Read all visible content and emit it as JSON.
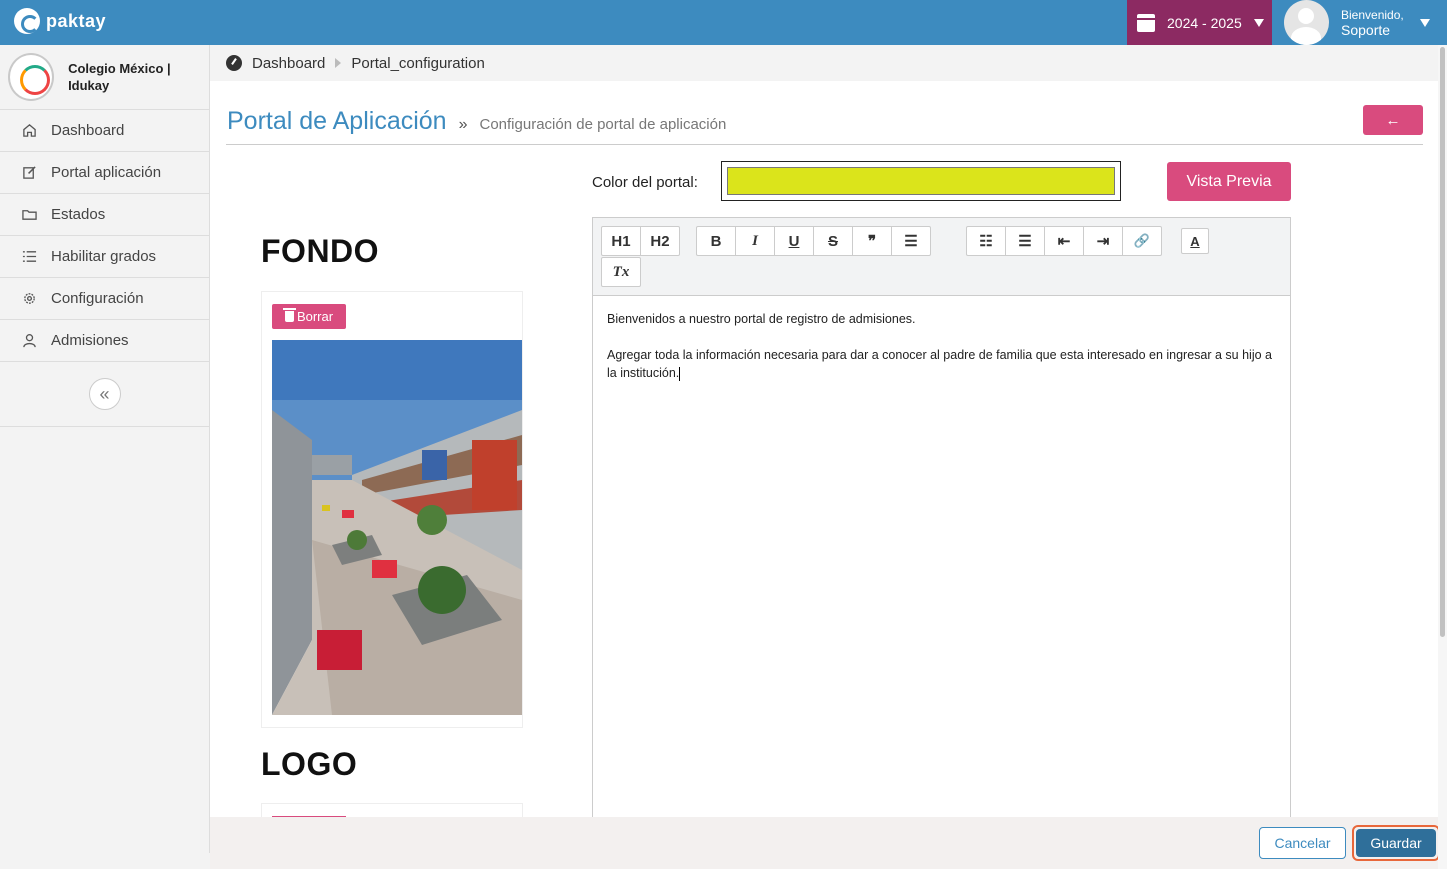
{
  "topbar": {
    "brand": "paktay",
    "school_year": "2024 - 2025",
    "greeting": "Bienvenido,",
    "user_name": "Soporte",
    "bg_color": "#3d8bbf",
    "year_bg_color": "#8c2a62"
  },
  "sidebar": {
    "school_name": "Colegio México | Idukay",
    "items": [
      {
        "label": "Dashboard",
        "icon": "home-icon"
      },
      {
        "label": "Portal aplicación",
        "icon": "edit-icon"
      },
      {
        "label": "Estados",
        "icon": "folder-icon"
      },
      {
        "label": "Habilitar grados",
        "icon": "list-icon"
      },
      {
        "label": "Configuración",
        "icon": "gear-icon"
      },
      {
        "label": "Admisiones",
        "icon": "user-icon"
      }
    ],
    "collapse_glyph": "«"
  },
  "breadcrumb": {
    "items": [
      "Dashboard",
      "Portal_configuration"
    ]
  },
  "page": {
    "title": "Portal de Aplicación",
    "separator": "»",
    "subtitle": "Configuración de portal de aplicación",
    "back_glyph": "←",
    "color_label": "Color del portal:",
    "portal_color": "#dbe41b",
    "preview_label": "Vista Previa",
    "accent_color": "#d94b7e"
  },
  "sections": {
    "fondo_title": "FONDO",
    "logo_title": "LOGO",
    "delete_label": "Borrar"
  },
  "editor": {
    "toolbar": {
      "h1": "H1",
      "h2": "H2",
      "bold": "B",
      "italic": "I",
      "underline": "U",
      "strike": "S",
      "quote": "❞",
      "align": "☰",
      "ordered_list": "☷",
      "bullet_list": "☰",
      "outdent": "⇤",
      "indent": "⇥",
      "link": "🔗",
      "text_color": "A",
      "clear_format": "Tx"
    },
    "paragraph_1": "Bienvenidos a nuestro portal de registro de admisiones.",
    "paragraph_2": "Agregar toda la información necesaria para dar a conocer al padre de familia que esta interesado en ingresar a su hijo a la institución."
  },
  "footer": {
    "cancel_label": "Cancelar",
    "save_label": "Guardar"
  }
}
